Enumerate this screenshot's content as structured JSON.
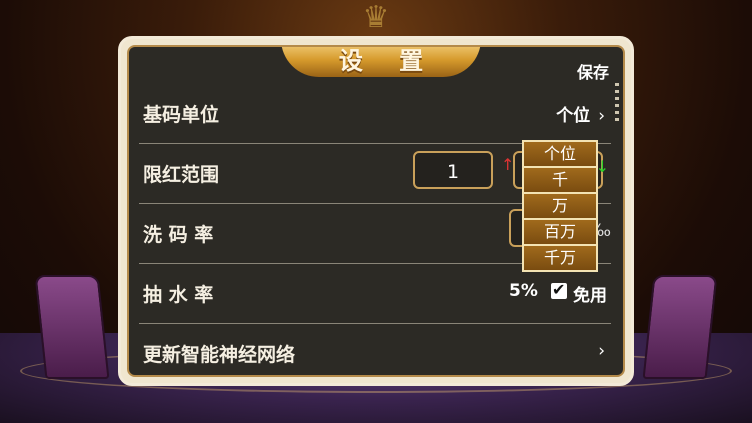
{
  "panel": {
    "title": "设 置",
    "save_label": "保存"
  },
  "rows": {
    "base_unit": {
      "label": "基码单位",
      "value": "个位",
      "chevron": "›"
    },
    "limit_range": {
      "label": "限红范围",
      "value": "1",
      "up_arrow": "↑",
      "down_arrow": "↓"
    },
    "wash_rate": {
      "label": "洗 码 率",
      "unit": "‰"
    },
    "draw_rate": {
      "label": "抽 水 率",
      "value": "5%",
      "checked": true,
      "free_label": "免用"
    },
    "update_nn": {
      "label": "更新智能神经网络",
      "chevron": "›"
    }
  },
  "dropdown": {
    "options": [
      "个位",
      "千",
      "万",
      "百万",
      "千万"
    ]
  },
  "icons": {
    "crest": "lion-crest-icon",
    "check": "✔"
  },
  "colors": {
    "panel_bg": "#2c2a25",
    "gold": "#d69a2c",
    "option_bg": "#8a5a18"
  }
}
